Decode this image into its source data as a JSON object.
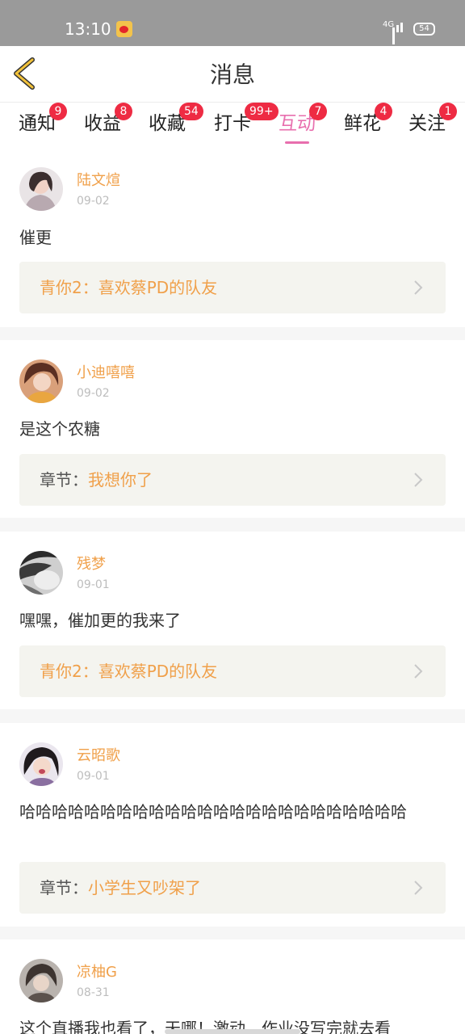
{
  "status_bar": {
    "time": "13:10",
    "network": "4G",
    "battery": "54"
  },
  "header": {
    "title": "消息",
    "back_icon": "chevron-left-icon"
  },
  "colors": {
    "accent_pink": "#e86fae",
    "accent_orange": "#f0a04a",
    "badge_red": "#ee2b43"
  },
  "tabs": [
    {
      "label": "通知",
      "badge": "9"
    },
    {
      "label": "收益",
      "badge": "8"
    },
    {
      "label": "收藏",
      "badge": "54"
    },
    {
      "label": "打卡",
      "badge": "99+"
    },
    {
      "label": "互动",
      "badge": "7",
      "active": true
    },
    {
      "label": "鲜花",
      "badge": "4"
    },
    {
      "label": "关注",
      "badge": "1"
    }
  ],
  "messages": [
    {
      "name": "陆文煊",
      "date": "09-02",
      "comment": "催更",
      "ref_prefix": "",
      "ref_link": "青你2：喜欢蔡PD的队友"
    },
    {
      "name": "小迪嘻嘻",
      "date": "09-02",
      "comment": "是这个农糖",
      "ref_prefix": "章节：",
      "ref_link": "我想你了"
    },
    {
      "name": "残梦",
      "date": "09-01",
      "comment": "嘿嘿，催加更的我来了",
      "ref_prefix": "",
      "ref_link": "青你2：喜欢蔡PD的队友"
    },
    {
      "name": "云昭歌",
      "date": "09-01",
      "comment": "哈哈哈哈哈哈哈哈哈哈哈哈哈哈哈哈哈哈哈哈哈哈哈哈",
      "ref_prefix": "章节：",
      "ref_link": "小学生又吵架了"
    },
    {
      "name": "凉柚G",
      "date": "08-31",
      "comment": "这个直播我也看了，天哪！激动，作业没写完就去看"
    }
  ]
}
